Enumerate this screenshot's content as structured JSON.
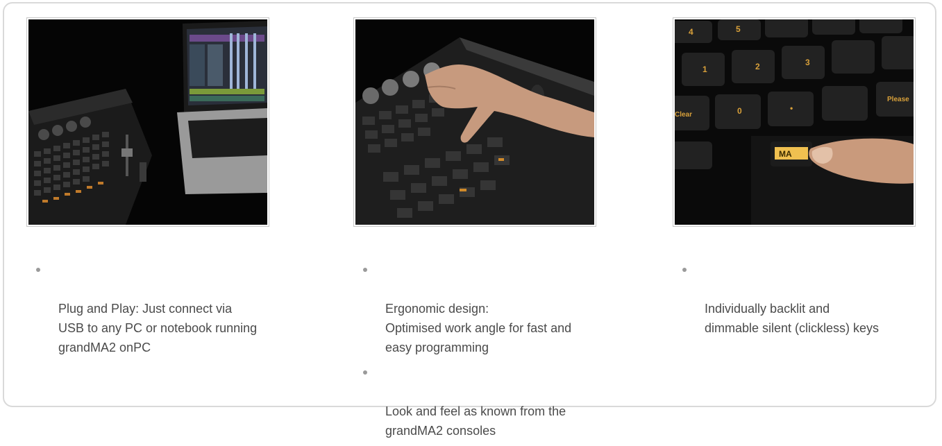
{
  "columns": [
    {
      "id": "onpc",
      "bullets": [
        "Plug and Play: Just connect via\nUSB to any PC or notebook running\ngrandMA2 onPC"
      ]
    },
    {
      "id": "ergonomic",
      "bullets": [
        "Ergonomic design:\nOptimised work angle for fast and\neasy programming",
        "Look and feel as known from the\ngrandMA2 consoles"
      ]
    },
    {
      "id": "keys",
      "bullets": [
        "Individually backlit and\ndimmable silent (clickless) keys"
      ]
    }
  ],
  "photo3_key_labels": [
    "4",
    "5",
    "3",
    "2",
    "1",
    "0",
    "•",
    "MA",
    "Clear",
    "Please"
  ],
  "colors": {
    "border": "#d9d9d9",
    "text": "#4a4a4a",
    "bullet": "#9a9a9a",
    "photo_bg": "#0a0a0a",
    "key_glow": "#e8a23a"
  }
}
